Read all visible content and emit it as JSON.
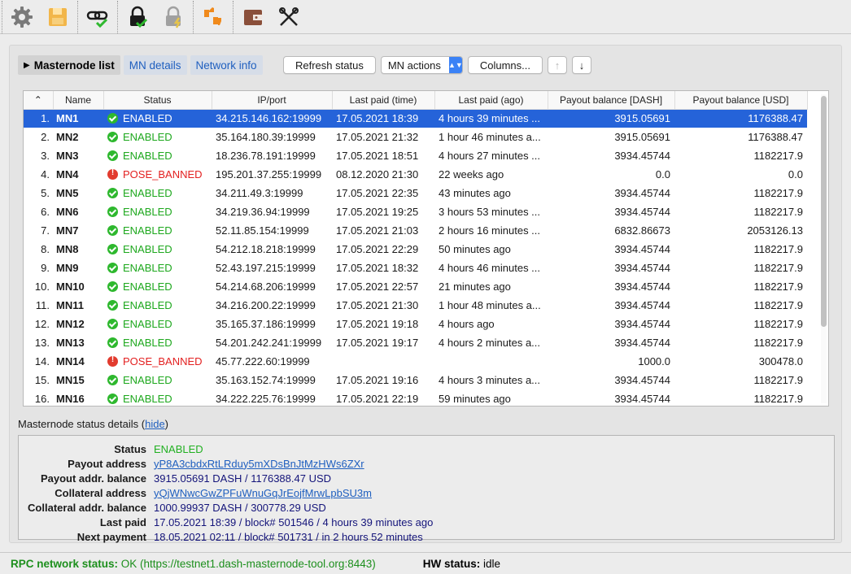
{
  "toolbar": {
    "icons": [
      "gear-icon",
      "save-icon",
      "link-check-icon",
      "lock-check-icon",
      "lock-lightning-icon",
      "thumbs-icon",
      "wallet-icon",
      "tools-icon"
    ]
  },
  "tabs": [
    {
      "label": "Masternode list"
    },
    {
      "label": "MN details"
    },
    {
      "label": "Network info"
    }
  ],
  "controls": {
    "refresh": "Refresh status",
    "mn_actions": "MN actions",
    "columns": "Columns...",
    "up": "↑",
    "down": "↓"
  },
  "table": {
    "headers": [
      "",
      "Name",
      "Status",
      "IP/port",
      "Last paid (time)",
      "Last paid (ago)",
      "Payout balance [DASH]",
      "Payout balance [USD]"
    ],
    "sort_indicator": "^",
    "rows": [
      {
        "idx": "1.",
        "name": "MN1",
        "status": "ENABLED",
        "ok": true,
        "ip": "34.215.146.162:19999",
        "time": "17.05.2021 18:39",
        "ago": "4 hours 39 minutes ...",
        "dash": "3915.05691",
        "usd": "1176388.47",
        "selected": true
      },
      {
        "idx": "2.",
        "name": "MN2",
        "status": "ENABLED",
        "ok": true,
        "ip": "35.164.180.39:19999",
        "time": "17.05.2021 21:32",
        "ago": "1 hour 46 minutes a...",
        "dash": "3915.05691",
        "usd": "1176388.47"
      },
      {
        "idx": "3.",
        "name": "MN3",
        "status": "ENABLED",
        "ok": true,
        "ip": "18.236.78.191:19999",
        "time": "17.05.2021 18:51",
        "ago": "4 hours 27 minutes ...",
        "dash": "3934.45744",
        "usd": "1182217.9"
      },
      {
        "idx": "4.",
        "name": "MN4",
        "status": "POSE_BANNED",
        "ok": false,
        "ip": "195.201.37.255:19999",
        "time": "08.12.2020 21:30",
        "ago": "22 weeks ago",
        "dash": "0.0",
        "usd": "0.0"
      },
      {
        "idx": "5.",
        "name": "MN5",
        "status": "ENABLED",
        "ok": true,
        "ip": "34.211.49.3:19999",
        "time": "17.05.2021 22:35",
        "ago": "43 minutes ago",
        "dash": "3934.45744",
        "usd": "1182217.9"
      },
      {
        "idx": "6.",
        "name": "MN6",
        "status": "ENABLED",
        "ok": true,
        "ip": "34.219.36.94:19999",
        "time": "17.05.2021 19:25",
        "ago": "3 hours 53 minutes ...",
        "dash": "3934.45744",
        "usd": "1182217.9"
      },
      {
        "idx": "7.",
        "name": "MN7",
        "status": "ENABLED",
        "ok": true,
        "ip": "52.11.85.154:19999",
        "time": "17.05.2021 21:03",
        "ago": "2 hours 16 minutes ...",
        "dash": "6832.86673",
        "usd": "2053126.13"
      },
      {
        "idx": "8.",
        "name": "MN8",
        "status": "ENABLED",
        "ok": true,
        "ip": "54.212.18.218:19999",
        "time": "17.05.2021 22:29",
        "ago": "50 minutes ago",
        "dash": "3934.45744",
        "usd": "1182217.9"
      },
      {
        "idx": "9.",
        "name": "MN9",
        "status": "ENABLED",
        "ok": true,
        "ip": "52.43.197.215:19999",
        "time": "17.05.2021 18:32",
        "ago": "4 hours 46 minutes ...",
        "dash": "3934.45744",
        "usd": "1182217.9"
      },
      {
        "idx": "10.",
        "name": "MN10",
        "status": "ENABLED",
        "ok": true,
        "ip": "54.214.68.206:19999",
        "time": "17.05.2021 22:57",
        "ago": "21 minutes ago",
        "dash": "3934.45744",
        "usd": "1182217.9"
      },
      {
        "idx": "11.",
        "name": "MN11",
        "status": "ENABLED",
        "ok": true,
        "ip": "34.216.200.22:19999",
        "time": "17.05.2021 21:30",
        "ago": "1 hour 48 minutes a...",
        "dash": "3934.45744",
        "usd": "1182217.9"
      },
      {
        "idx": "12.",
        "name": "MN12",
        "status": "ENABLED",
        "ok": true,
        "ip": "35.165.37.186:19999",
        "time": "17.05.2021 19:18",
        "ago": "4 hours ago",
        "dash": "3934.45744",
        "usd": "1182217.9"
      },
      {
        "idx": "13.",
        "name": "MN13",
        "status": "ENABLED",
        "ok": true,
        "ip": "54.201.242.241:19999",
        "time": "17.05.2021 19:17",
        "ago": "4 hours 2 minutes a...",
        "dash": "3934.45744",
        "usd": "1182217.9"
      },
      {
        "idx": "14.",
        "name": "MN14",
        "status": "POSE_BANNED",
        "ok": false,
        "ip": "45.77.222.60:19999",
        "time": "",
        "ago": "",
        "dash": "1000.0",
        "usd": "300478.0"
      },
      {
        "idx": "15.",
        "name": "MN15",
        "status": "ENABLED",
        "ok": true,
        "ip": "35.163.152.74:19999",
        "time": "17.05.2021 19:16",
        "ago": "4 hours 3 minutes a...",
        "dash": "3934.45744",
        "usd": "1182217.9"
      },
      {
        "idx": "16.",
        "name": "MN16",
        "status": "ENABLED",
        "ok": true,
        "ip": "34.222.225.76:19999",
        "time": "17.05.2021 22:19",
        "ago": "59 minutes ago",
        "dash": "3934.45744",
        "usd": "1182217.9"
      }
    ]
  },
  "details": {
    "label": "Masternode status details",
    "hide_link": "hide",
    "rows": [
      {
        "key": "Status",
        "value": "ENABLED",
        "style": "green"
      },
      {
        "key": "Payout address",
        "value": "yP8A3cbdxRtLRduy5mXDsBnJtMzHWs6ZXr",
        "style": "link"
      },
      {
        "key": "Payout addr. balance",
        "value": "3915.05691 DASH / 1176388.47 USD",
        "style": ""
      },
      {
        "key": "Collateral address",
        "value": "yQjWNwcGwZPFuWnuGqJrEojfMrwLpbSU3m",
        "style": "link"
      },
      {
        "key": "Collateral addr. balance",
        "value": "1000.99937 DASH / 300778.29 USD",
        "style": ""
      },
      {
        "key": "Last paid",
        "value": "17.05.2021 18:39 / block# 501546 / 4 hours 39 minutes ago",
        "style": ""
      },
      {
        "key": "Next payment",
        "value": "18.05.2021 02:11 / block# 501731 / in 2 hours 52 minutes",
        "style": ""
      }
    ]
  },
  "statusbar": {
    "rpc_label": "RPC network status:",
    "rpc_value": "OK (https://testnet1.dash-masternode-tool.org:8443)",
    "hw_label": "HW status:",
    "hw_value": "idle"
  }
}
